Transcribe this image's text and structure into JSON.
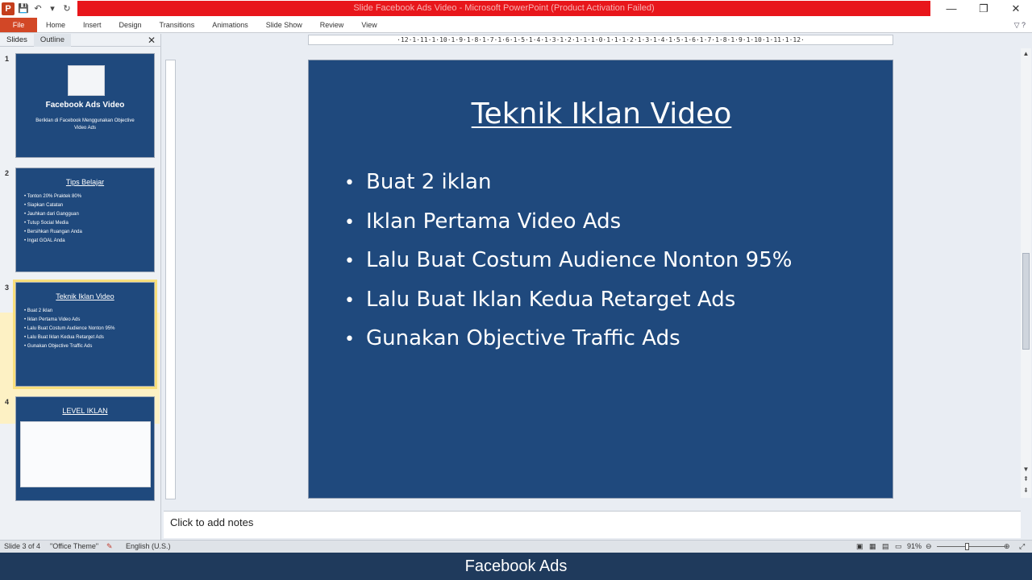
{
  "window": {
    "title": "Slide Facebook Ads Video - Microsoft PowerPoint (Product Activation Failed)",
    "logo": "P",
    "minimize_icon": "—",
    "restore_icon": "❐",
    "close_icon": "✕"
  },
  "qat": {
    "save_icon": "💾",
    "undo_icon": "↶",
    "undo_dropdown_icon": "▾",
    "redo_icon": "↻",
    "customize_icon": "▾"
  },
  "ribbon": {
    "tabs": [
      "File",
      "Home",
      "Insert",
      "Design",
      "Transitions",
      "Animations",
      "Slide Show",
      "Review",
      "View"
    ],
    "help": "▽ ?"
  },
  "left_panel": {
    "tabs": [
      "Slides",
      "Outline"
    ],
    "close_icon": "✕",
    "thumbnails": [
      {
        "number": "1",
        "title": "Facebook Ads Video",
        "subtitle": "Beriklan di Facebook Menggunakan Objective Video Ads"
      },
      {
        "number": "2",
        "title": "Tips Belajar",
        "bullets": [
          "Tonton 20% Praktek 80%",
          "Siapkan Catatan",
          "Jauhkan dari Gangguan",
          "Tutup Social Media",
          "Bersihkan Ruangan Anda",
          "Ingat GOAL Anda"
        ]
      },
      {
        "number": "3",
        "title": "Teknik Iklan Video",
        "bullets": [
          "Buat 2 iklan",
          "Iklan Pertama Video Ads",
          "Lalu Buat Costum Audience Nonton 95%",
          "Lalu Buat Iklan Kedua Retarget Ads",
          "Gunakan Objective Traffic Ads"
        ]
      },
      {
        "number": "4",
        "title": "LEVEL IKLAN"
      }
    ]
  },
  "ruler": {
    "horizontal": "·12·1·11·1·10·1·9·1·8·1·7·1·6·1·5·1·4·1·3·1·2·1·1·1·0·1·1·1·2·1·3·1·4·1·5·1·6·1·7·1·8·1·9·1·10·1·11·1·12·"
  },
  "slide": {
    "title": "Teknik Iklan Video",
    "bullet_char": "•",
    "bullets": [
      "Buat 2 iklan",
      "Iklan Pertama Video Ads",
      "Lalu Buat Costum Audience Nonton 95%",
      "Lalu Buat Iklan Kedua Retarget Ads",
      "Gunakan Objective Traffic Ads"
    ]
  },
  "scrollbar": {
    "up_icon": "▲",
    "down_icon": "▼",
    "prev_slide_icon": "⇞",
    "next_slide_icon": "⇟"
  },
  "notes": {
    "placeholder": "Click to add notes"
  },
  "status": {
    "slide_info": "Slide 3 of 4",
    "theme": "\"Office Theme\"",
    "language": "English (U.S.)",
    "zoom": "91%",
    "zoom_out_icon": "⊖",
    "zoom_in_icon": "⊕",
    "fit_icon": "⤢"
  },
  "caption": {
    "text": "Facebook Ads"
  },
  "colors": {
    "slide_bg": "#1f497d",
    "file_tab": "#d24726",
    "title_bar_red": "#e8161b",
    "selected_thumb": "#f8df7c",
    "caption_bg": "#1f3a5c"
  }
}
